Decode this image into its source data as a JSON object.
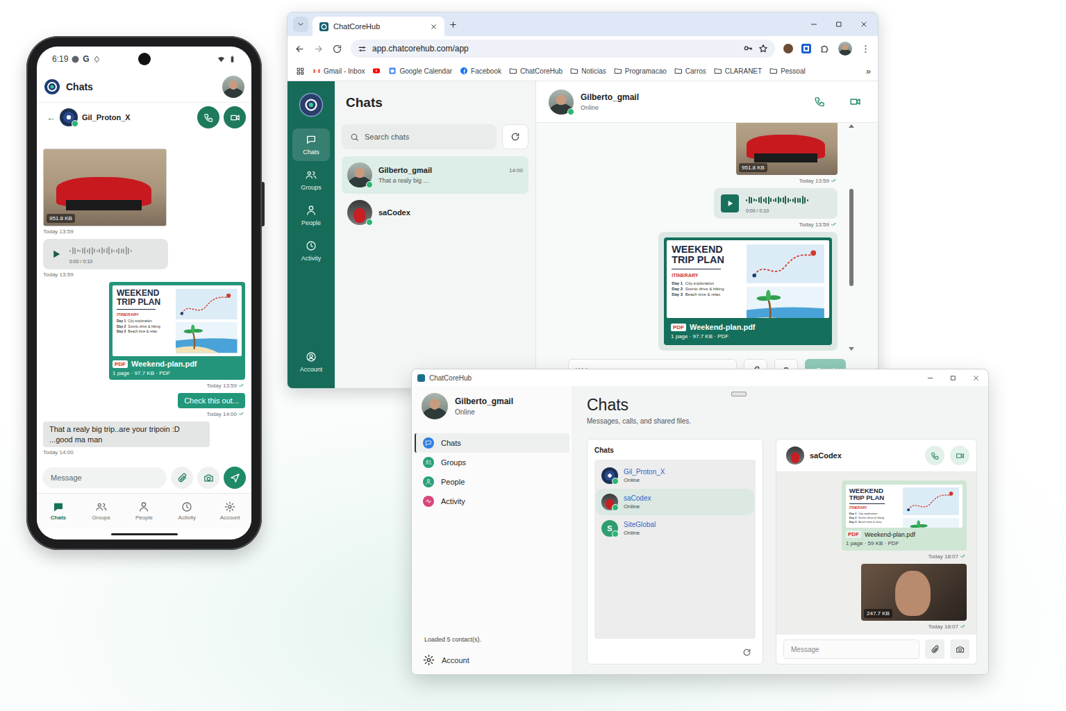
{
  "phone": {
    "status_bar": {
      "time": "6:19",
      "google": "G"
    },
    "header": {
      "title": "Chats"
    },
    "chat_header": {
      "back": "←",
      "name": "Gil_Proton_X",
      "online": true
    },
    "messages": [
      {
        "kind": "image",
        "outgoing": false,
        "size": "951.8 KB",
        "time": "Today 13:59",
        "read": false
      },
      {
        "kind": "audio",
        "outgoing": false,
        "duration": "0:00 / 0:10",
        "time": "Today 13:59",
        "read": false
      },
      {
        "kind": "pdf",
        "outgoing": true,
        "file": "Weekend-plan.pdf",
        "meta": "1 page · 97.7 KB · PDF",
        "time": "Today 13:59",
        "read": true
      },
      {
        "kind": "text",
        "outgoing": true,
        "text": "Check this out...",
        "time": "Today 14:00",
        "read": true
      },
      {
        "kind": "text",
        "outgoing": false,
        "text": "That a realy big trip..are your tripoin :D ...good ma man",
        "time": "Today 14:00",
        "read": false
      }
    ],
    "composer": {
      "placeholder": "Message"
    },
    "nav": [
      {
        "label": "Chats",
        "selected": true
      },
      {
        "label": "Groups",
        "selected": false
      },
      {
        "label": "People",
        "selected": false
      },
      {
        "label": "Activity",
        "selected": false
      },
      {
        "label": "Account",
        "selected": false
      }
    ]
  },
  "pdf_preview": {
    "title_lines": [
      "WEEKEND",
      "TRIP PLAN"
    ],
    "section": "ITINERARY",
    "days": [
      {
        "day": "Day 1",
        "plan": "City exploration"
      },
      {
        "day": "Day 2",
        "plan": "Scenic drive & hiking"
      },
      {
        "day": "Day 3",
        "plan": "Beach time & relax"
      }
    ],
    "badge": "PDF"
  },
  "browser": {
    "tab": {
      "title": "ChatCoreHub"
    },
    "address": "app.chatcorehub.com/app",
    "bookmarks": [
      {
        "kind": "gmail",
        "label": "Gmail - Inbox"
      },
      {
        "kind": "youtube"
      },
      {
        "kind": "calendar",
        "label": "Google Calendar"
      },
      {
        "kind": "facebook",
        "label": "Facebook"
      },
      {
        "kind": "folder",
        "label": "ChatCoreHub"
      },
      {
        "kind": "folder",
        "label": "Noticias"
      },
      {
        "kind": "folder",
        "label": "Programacao"
      },
      {
        "kind": "folder",
        "label": "Carros"
      },
      {
        "kind": "folder",
        "label": "CLARANET"
      },
      {
        "kind": "folder",
        "label": "Pessoal"
      }
    ],
    "overflow": "»",
    "rail": [
      {
        "label": "Chats",
        "selected": true
      },
      {
        "label": "Groups",
        "selected": false
      },
      {
        "label": "People",
        "selected": false
      },
      {
        "label": "Activity",
        "selected": false
      }
    ],
    "rail_account": "Account",
    "list_title": "Chats",
    "search_placeholder": "Search chats",
    "chats": [
      {
        "name": "Gilberto_gmail",
        "preview": "That a realy big ...",
        "time": "14:00",
        "selected": true,
        "avatar": "photo",
        "online": true
      },
      {
        "name": "saCodex",
        "selected": false,
        "avatar": "car",
        "online": true
      }
    ],
    "conversation": {
      "name": "Gilberto_gmail",
      "status": "Online",
      "messages": [
        {
          "kind": "image",
          "outgoing": true,
          "size": "951.8 KB",
          "time": "Today 13:59",
          "read": true
        },
        {
          "kind": "audio",
          "outgoing": true,
          "duration": "0:00 / 0:10",
          "time": "Today 13:59",
          "read": true
        },
        {
          "kind": "pdf",
          "outgoing": true,
          "file": "Weekend-plan.pdf",
          "meta": "1 page · 97.7 KB · PDF",
          "read": false
        }
      ]
    },
    "composer": {
      "placeholder": "Write a message",
      "send": "Send"
    }
  },
  "desktop": {
    "title": "ChatCoreHub",
    "profile": {
      "name": "Gilberto_gmail",
      "status": "Online"
    },
    "nav": [
      {
        "label": "Chats",
        "selected": true,
        "color": "#2f7fe0"
      },
      {
        "label": "Groups",
        "selected": false,
        "color": "#2aa07a"
      },
      {
        "label": "People",
        "selected": false,
        "color": "#2aa07a"
      },
      {
        "label": "Activity",
        "selected": false,
        "color": "#d8457a"
      }
    ],
    "footer_note": "Loaded 5 contact(s).",
    "account": "Account",
    "heading": "Chats",
    "subheading": "Messages, calls, and shared files.",
    "list_title": "Chats",
    "contacts": [
      {
        "name": "Gil_Proton_X",
        "status": "Online",
        "selected": false,
        "avatar": "logo",
        "online": true
      },
      {
        "name": "saCodex",
        "status": "Online",
        "selected": true,
        "avatar": "car",
        "online": true
      },
      {
        "name": "SiteGlobal",
        "status": "Online",
        "selected": false,
        "avatar": "initial",
        "initial": "S",
        "online": true
      }
    ],
    "conversation": {
      "name": "saCodex",
      "messages": [
        {
          "kind": "pdf",
          "outgoing": true,
          "file": "Weekend-plan.pdf",
          "meta": "1 page · 59 KB · PDF",
          "time": "Today 18:07",
          "read": true
        },
        {
          "kind": "image",
          "outgoing": true,
          "size": "247.7 KB",
          "time": "Today 18:07",
          "read": true
        }
      ]
    },
    "composer": {
      "placeholder": "Message"
    }
  }
}
